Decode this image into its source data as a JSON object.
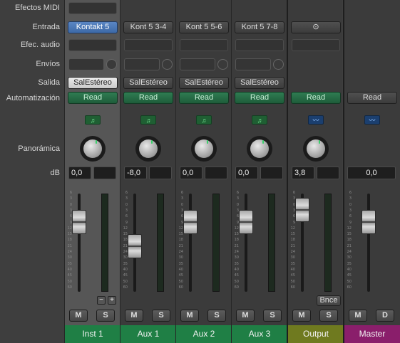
{
  "row_labels": {
    "midi_fx": "Efectos MIDI",
    "input": "Entrada",
    "audio_fx": "Efec. audio",
    "sends": "Envíos",
    "output": "Salida",
    "automation": "Automatización",
    "pan": "Panorámica",
    "db": "dB"
  },
  "scale_ticks": [
    "6",
    "3",
    "0",
    "3",
    "6",
    "9",
    "12",
    "15",
    "18",
    "21",
    "24",
    "30",
    "35",
    "40",
    "45",
    "50",
    "60"
  ],
  "channels": [
    {
      "name": "Inst 1",
      "input": "Kontakt 5",
      "output": "SalEstéreo",
      "automation": "Read",
      "db": "0,0",
      "fader_db": 0,
      "icon": "midi-region-icon",
      "name_color": "#1f7f45"
    },
    {
      "name": "Aux 1",
      "input": "Kont 5 3-4",
      "output": "SalEstéreo",
      "automation": "Read",
      "db": "-8,0",
      "fader_db": -8,
      "icon": "midi-region-icon",
      "name_color": "#1f7f45"
    },
    {
      "name": "Aux 2",
      "input": "Kont 5 5-6",
      "output": "SalEstéreo",
      "automation": "Read",
      "db": "0,0",
      "fader_db": 0,
      "icon": "midi-region-icon",
      "name_color": "#1f7f45"
    },
    {
      "name": "Aux 3",
      "input": "Kont 5 7-8",
      "output": "SalEstéreo",
      "automation": "Read",
      "db": "0,0",
      "fader_db": 0,
      "icon": "midi-region-icon",
      "name_color": "#1f7f45"
    },
    {
      "name": "Output",
      "input": "⊙",
      "output": "",
      "automation": "Read",
      "db": "3,8",
      "fader_db": 3.8,
      "icon": "audio-waveform-icon",
      "name_color": "#6f7a1f"
    },
    {
      "name": "Master",
      "input": "",
      "output": "",
      "automation": "Read",
      "db": "0,0",
      "fader_db": 0,
      "icon": "audio-waveform-icon",
      "name_color": "#8a1e6b"
    }
  ],
  "buttons": {
    "mute": "M",
    "solo": "S",
    "dim": "D",
    "bounce": "Bnce",
    "minus": "−",
    "plus": "+"
  }
}
